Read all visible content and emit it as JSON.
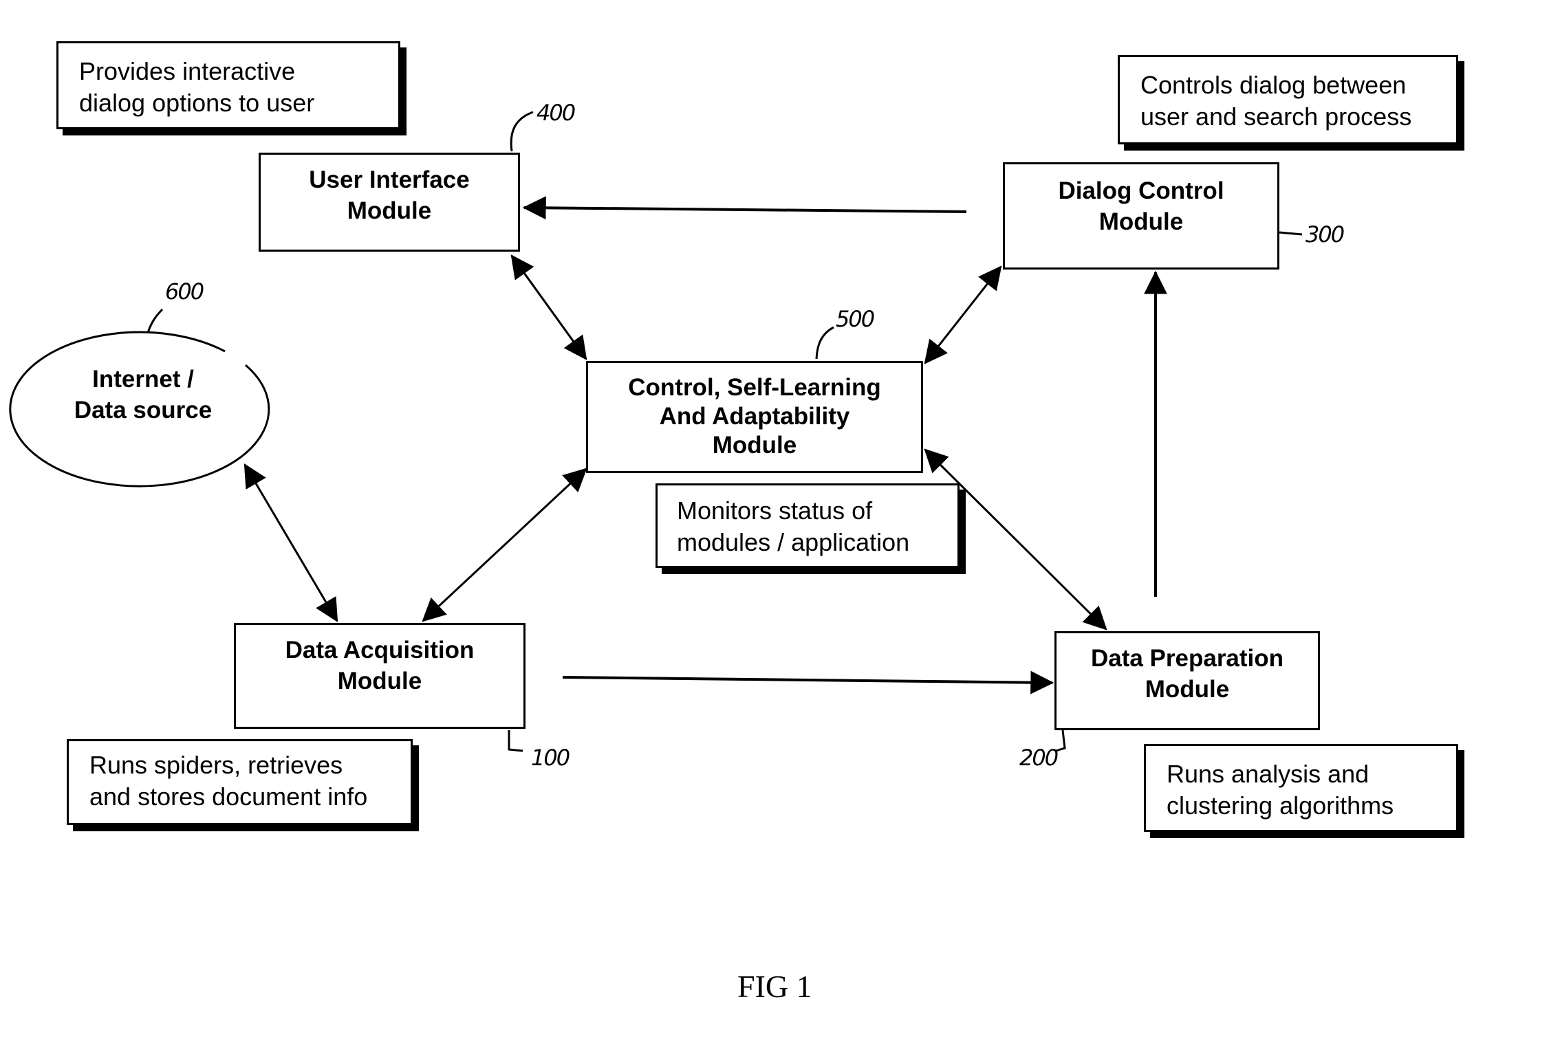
{
  "figure": {
    "caption": "FIG 1"
  },
  "modules": {
    "user_interface": {
      "line1": "User Interface",
      "line2": "Module",
      "ref": "400"
    },
    "dialog_control": {
      "line1": "Dialog Control",
      "line2": "Module",
      "ref": "300"
    },
    "control_center": {
      "line1": "Control, Self-Learning",
      "line2": "And Adaptability",
      "line3": "Module",
      "ref": "500"
    },
    "data_acquisition": {
      "line1": "Data Acquisition",
      "line2": "Module",
      "ref": "100"
    },
    "data_preparation": {
      "line1": "Data Preparation",
      "line2": "Module",
      "ref": "200"
    },
    "data_source": {
      "line1": "Internet /",
      "line2": "Data source",
      "ref": "600"
    }
  },
  "notes": {
    "user_interface": {
      "line1": "Provides interactive",
      "line2": "dialog options to user"
    },
    "dialog_control": {
      "line1": "Controls dialog between",
      "line2": "user and search process"
    },
    "control_center": {
      "line1": "Monitors status of",
      "line2": "modules / application"
    },
    "data_acquisition": {
      "line1": "Runs spiders, retrieves",
      "line2": "and stores document info"
    },
    "data_preparation": {
      "line1": "Runs analysis and",
      "line2": "clustering algorithms"
    }
  },
  "connections": [
    {
      "from": "dialog_control",
      "to": "user_interface",
      "direction": "one-way"
    },
    {
      "from": "user_interface",
      "to": "control_center",
      "direction": "two-way"
    },
    {
      "from": "dialog_control",
      "to": "control_center",
      "direction": "two-way"
    },
    {
      "from": "data_source",
      "to": "data_acquisition",
      "direction": "two-way"
    },
    {
      "from": "data_acquisition",
      "to": "control_center",
      "direction": "two-way"
    },
    {
      "from": "control_center",
      "to": "data_preparation",
      "direction": "two-way"
    },
    {
      "from": "data_acquisition",
      "to": "data_preparation",
      "direction": "one-way"
    },
    {
      "from": "data_preparation",
      "to": "dialog_control",
      "direction": "one-way"
    }
  ]
}
